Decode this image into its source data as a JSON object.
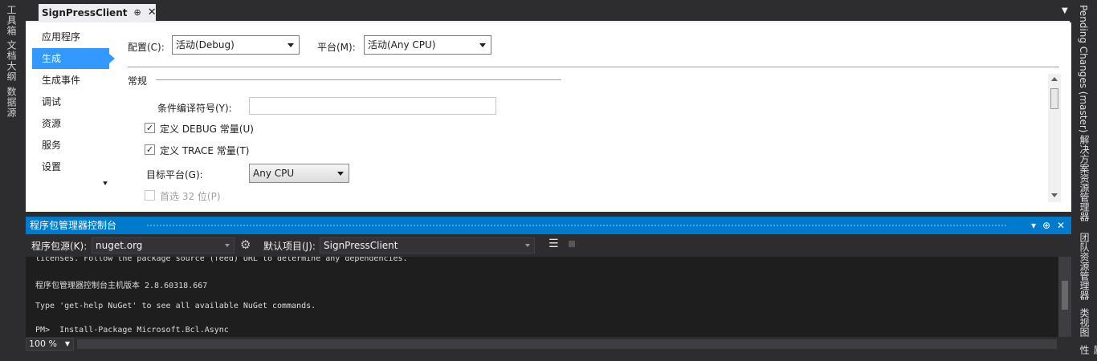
{
  "left_strip": {
    "tabs": [
      "工具箱",
      "文档大纲",
      "数据源"
    ]
  },
  "right_strip": {
    "tabs": [
      "Pending Changes (master)",
      "解决方案资源管理器",
      "团队资源管理器",
      "类视图",
      "属性"
    ]
  },
  "document_tab": {
    "title": "SignPressClient",
    "pin_glyph": "⊕",
    "close_glyph": "✕"
  },
  "properties": {
    "nav_items": [
      "应用程序",
      "生成",
      "生成事件",
      "调试",
      "资源",
      "服务",
      "设置"
    ],
    "selected_nav": "生成",
    "config_label": "配置(C):",
    "config_value": "活动(Debug)",
    "platform_label": "平台(M):",
    "platform_value": "活动(Any CPU)",
    "section_general": "常规",
    "conditional_symbols_label": "条件编译符号(Y):",
    "conditional_symbols_value": "",
    "define_debug_label": "定义 DEBUG 常量(U)",
    "define_debug_checked": true,
    "define_trace_label": "定义 TRACE 常量(T)",
    "define_trace_checked": true,
    "target_platform_label": "目标平台(G):",
    "target_platform_value": "Any CPU",
    "prefer32_label": "首选 32 位(P)",
    "prefer32_checked": false,
    "more_glyph": "⯆"
  },
  "package_manager": {
    "title": "程序包管理器控制台",
    "source_label": "程序包源(K):",
    "source_value": "nuget.org",
    "default_project_label": "默认项目(J):",
    "default_project_value": "SignPressClient",
    "console_lines": [
      "licenses. Follow the package source (feed) URL to determine any dependencies.",
      "程序包管理器控制台主机版本 2.8.60318.667",
      "Type 'get-help NuGet' to see all available NuGet commands.",
      "PM>  Install-Package Microsoft.Bcl.Async"
    ],
    "zoom": "100 %"
  },
  "colors": {
    "accent": "#007acc",
    "selection": "#3399ff",
    "background": "#2d2d30"
  }
}
